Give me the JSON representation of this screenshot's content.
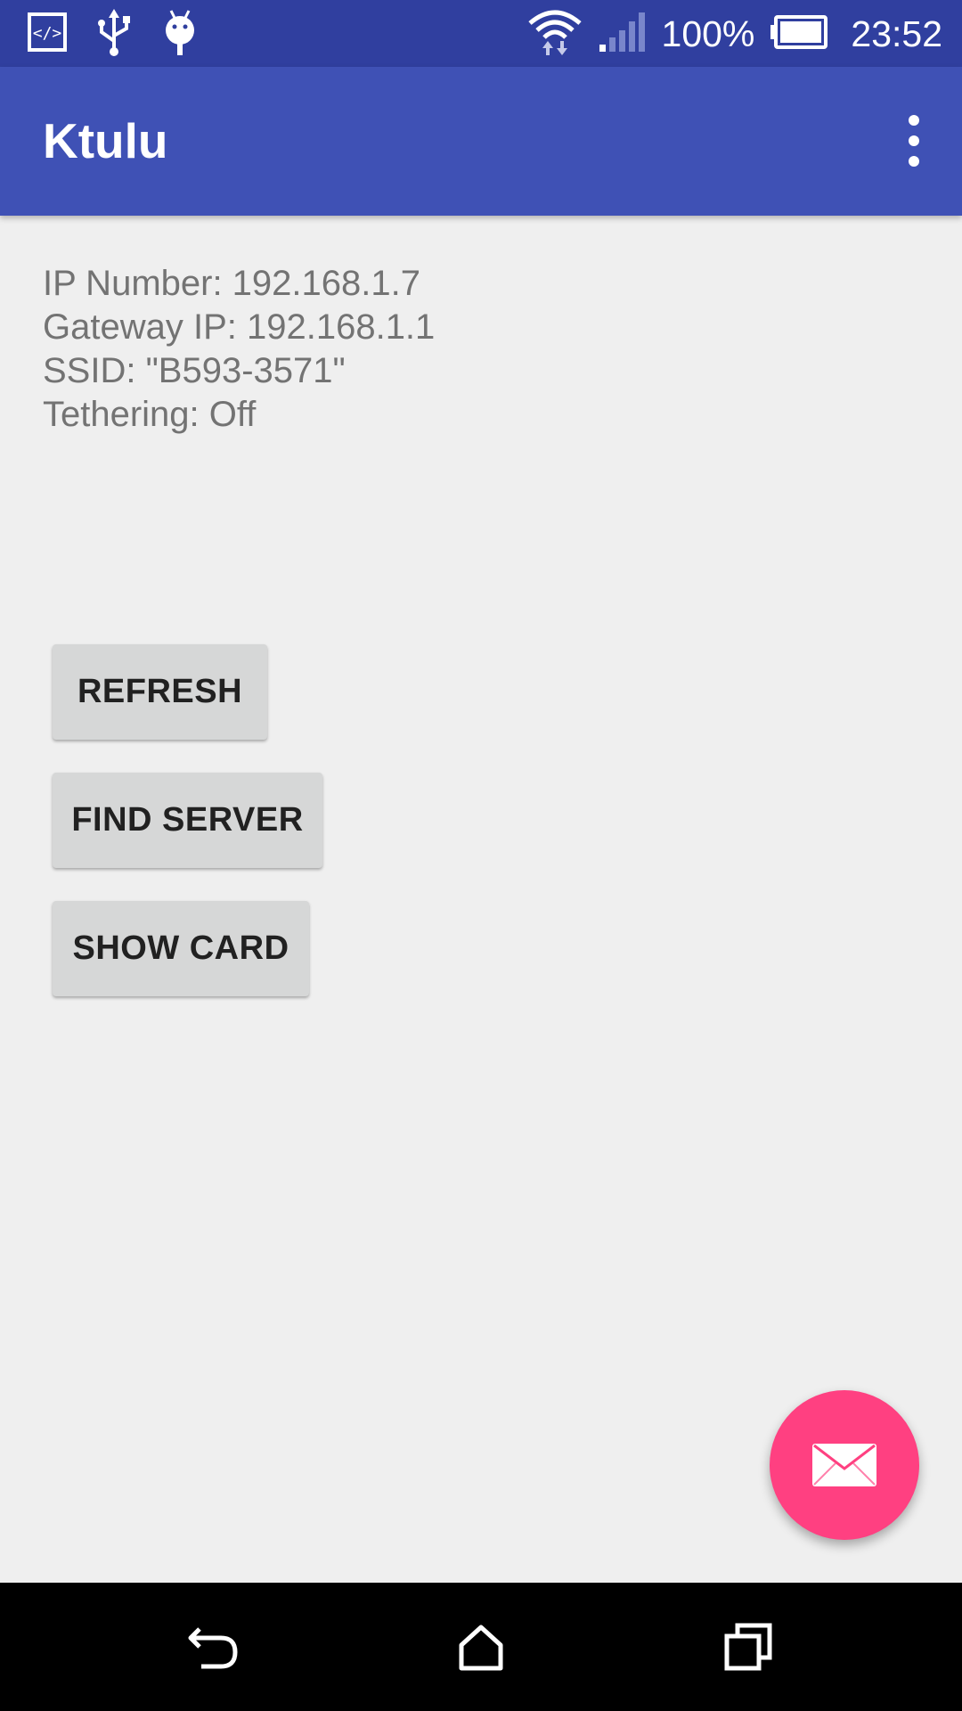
{
  "status_bar": {
    "battery_text": "100%",
    "time": "23:52",
    "icons": [
      "code-icon",
      "usb-icon",
      "android-debug-icon",
      "wifi-icon",
      "signal-icon",
      "battery-icon"
    ]
  },
  "app_bar": {
    "title": "Ktulu",
    "menu_icon": "overflow-menu-icon"
  },
  "info": {
    "ip_number": "IP Number: 192.168.1.7",
    "gateway_ip": "Gateway IP: 192.168.1.1",
    "ssid": "SSID: \"B593-3571\"",
    "tethering": "Tethering: Off"
  },
  "buttons": {
    "refresh": "REFRESH",
    "find_server": "FIND SERVER",
    "show_card": "SHOW CARD"
  },
  "fab": {
    "icon": "mail-icon"
  },
  "nav_bar": {
    "icons": [
      "back-icon",
      "home-icon",
      "recents-icon"
    ]
  },
  "colors": {
    "status_bar": "#303f9f",
    "primary": "#3f51b5",
    "accent": "#ff4081",
    "background": "#efefef",
    "button": "#d6d7d7"
  }
}
